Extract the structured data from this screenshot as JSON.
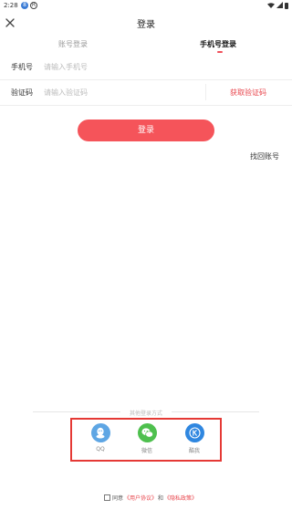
{
  "status_bar": {
    "time": "2:28",
    "badge_a": "8",
    "badge_b": "R"
  },
  "header": {
    "title": "登录",
    "close_icon": "close-icon"
  },
  "tabs": [
    {
      "label": "账号登录",
      "active": false
    },
    {
      "label": "手机号登录",
      "active": true
    }
  ],
  "form": {
    "phone_label": "手机号",
    "phone_placeholder": "请输入手机号",
    "phone_value": "",
    "code_label": "验证码",
    "code_placeholder": "请输入验证码",
    "code_value": "",
    "get_code_label": "获取验证码"
  },
  "login_button": "登录",
  "find_account": "找回账号",
  "other_login": {
    "title": "其他登录方式",
    "methods": [
      {
        "label": "QQ",
        "icon": "qq-icon"
      },
      {
        "label": "微信",
        "icon": "wechat-icon"
      },
      {
        "label": "酷我",
        "icon": "k-icon"
      }
    ]
  },
  "agreement": {
    "prefix": "同意",
    "user_agreement": "《用户协议》",
    "and": "和",
    "privacy_policy": "《隐私政策》",
    "checked": false
  },
  "colors": {
    "accent": "#f5545a",
    "link": "#e8454c",
    "qq": "#5ea6e4",
    "wechat": "#4ec04e",
    "kuwo": "#2f87e0",
    "highlight_box": "#e53935"
  }
}
